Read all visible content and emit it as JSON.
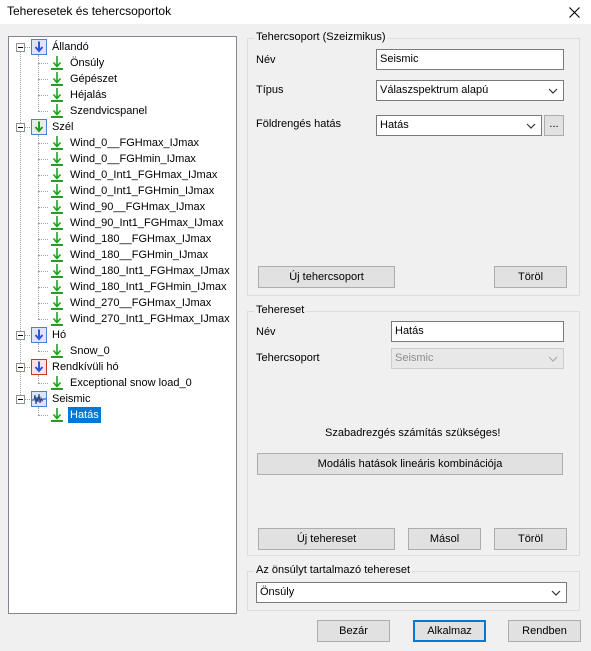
{
  "window": {
    "title": "Teheresetek és tehercsoportok",
    "close_icon": "close-icon"
  },
  "tree": {
    "items": [
      {
        "label": "Állandó",
        "icon": "load-group-down-blue",
        "level": 0
      },
      {
        "label": "Önsúly",
        "icon": "load-arrow-green",
        "level": 1
      },
      {
        "label": "Gépészet",
        "icon": "load-arrow-green",
        "level": 1
      },
      {
        "label": "Héjalás",
        "icon": "load-arrow-green",
        "level": 1
      },
      {
        "label": "Szendvicspanel",
        "icon": "load-arrow-green",
        "level": 1
      },
      {
        "label": "Szél",
        "icon": "load-group-down-green",
        "level": 0
      },
      {
        "label": "Wind_0__FGHmax_IJmax",
        "icon": "load-arrow-green",
        "level": 1
      },
      {
        "label": "Wind_0__FGHmin_IJmax",
        "icon": "load-arrow-green",
        "level": 1
      },
      {
        "label": "Wind_0_Int1_FGHmax_IJmax",
        "icon": "load-arrow-green",
        "level": 1
      },
      {
        "label": "Wind_0_Int1_FGHmin_IJmax",
        "icon": "load-arrow-green",
        "level": 1
      },
      {
        "label": "Wind_90__FGHmax_IJmax",
        "icon": "load-arrow-green",
        "level": 1
      },
      {
        "label": "Wind_90_Int1_FGHmax_IJmax",
        "icon": "load-arrow-green",
        "level": 1
      },
      {
        "label": "Wind_180__FGHmax_IJmax",
        "icon": "load-arrow-green",
        "level": 1
      },
      {
        "label": "Wind_180__FGHmin_IJmax",
        "icon": "load-arrow-green",
        "level": 1
      },
      {
        "label": "Wind_180_Int1_FGHmax_IJmax",
        "icon": "load-arrow-green",
        "level": 1
      },
      {
        "label": "Wind_180_Int1_FGHmin_IJmax",
        "icon": "load-arrow-green",
        "level": 1
      },
      {
        "label": "Wind_270__FGHmax_IJmax",
        "icon": "load-arrow-green",
        "level": 1
      },
      {
        "label": "Wind_270_Int1_FGHmax_IJmax",
        "icon": "load-arrow-green",
        "level": 1
      },
      {
        "label": "Hó",
        "icon": "load-group-down-blue",
        "level": 0
      },
      {
        "label": "Snow_0",
        "icon": "load-arrow-green",
        "level": 1
      },
      {
        "label": "Rendkívüli hó",
        "icon": "load-group-down-red",
        "level": 0
      },
      {
        "label": "Exceptional snow load_0",
        "icon": "load-arrow-green",
        "level": 1
      },
      {
        "label": "Seismic",
        "icon": "seismic-group",
        "level": 0
      },
      {
        "label": "Hatás",
        "icon": "load-arrow-green",
        "level": 1,
        "selected": true
      }
    ]
  },
  "tehercsoport": {
    "title": "Tehercsoport (Szeizmikus)",
    "nev_label": "Név",
    "nev_value": "Seismic",
    "tipus_label": "Típus",
    "tipus_value": "Válaszspektrum alapú",
    "foldrenges_label": "Földrengés hatás",
    "foldrenges_value": "Hatás",
    "ellipsis": "...",
    "new_button": "Új tehercsoport",
    "delete_button": "Töröl"
  },
  "tehereset": {
    "title": "Tehereset",
    "nev_label": "Név",
    "nev_value": "Hatás",
    "csoport_label": "Tehercsoport",
    "csoport_value": "Seismic",
    "info": "Szabadrezgés számítás szükséges!",
    "modal_button": "Modális hatások lineáris kombinációja",
    "new_button": "Új tehereset",
    "copy_button": "Másol",
    "delete_button": "Töröl"
  },
  "onsuly": {
    "title": "Az önsúlyt tartalmazó tehereset",
    "value": "Önsúly"
  },
  "footer": {
    "close": "Bezár",
    "apply": "Alkalmaz",
    "ok": "Rendben"
  },
  "colors": {
    "accent": "#0078d7",
    "arrow_green": "#1fa01f",
    "group_blue": "#4a7fd8",
    "group_red": "#c0392b"
  }
}
